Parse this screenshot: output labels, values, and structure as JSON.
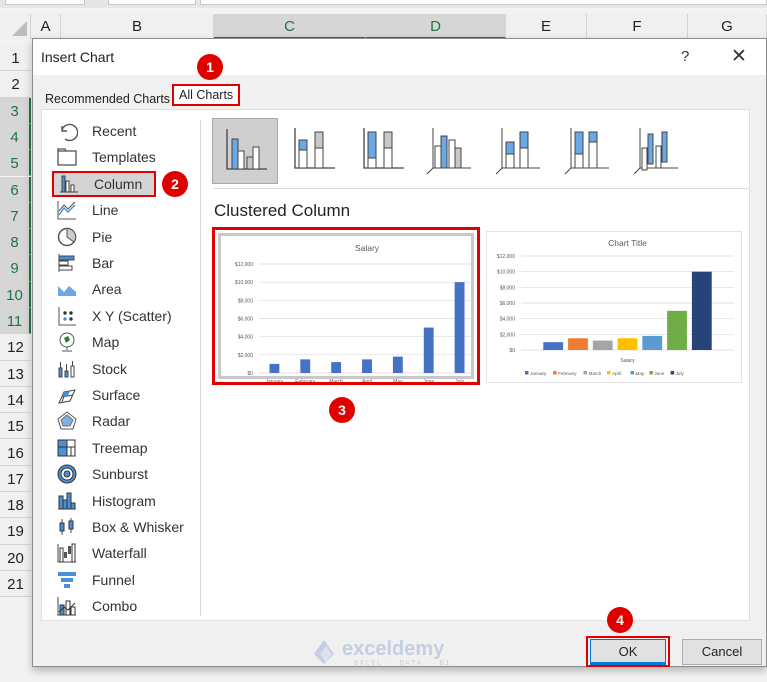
{
  "spreadsheet": {
    "columns": [
      "A",
      "B",
      "C",
      "D",
      "E",
      "F",
      "G"
    ],
    "selected_columns": [
      "C",
      "D"
    ],
    "rows": [
      "1",
      "2",
      "3",
      "4",
      "5",
      "6",
      "7",
      "8",
      "9",
      "10",
      "11",
      "12",
      "13",
      "14",
      "15",
      "16",
      "17",
      "18",
      "19",
      "20",
      "21"
    ],
    "selected_rows": [
      "3",
      "4",
      "5",
      "6",
      "7",
      "8",
      "9",
      "10",
      "11"
    ]
  },
  "dialog": {
    "title": "Insert Chart",
    "help_label": "?",
    "close_label": "✕",
    "tabs": [
      {
        "label": "Recommended Charts",
        "active": false
      },
      {
        "label": "All Charts",
        "active": true
      }
    ],
    "sidebar": {
      "items": [
        {
          "label": "Recent",
          "icon": "recent-icon"
        },
        {
          "label": "Templates",
          "icon": "templates-icon"
        },
        {
          "label": "Column",
          "icon": "column-chart-icon",
          "active": true
        },
        {
          "label": "Line",
          "icon": "line-chart-icon"
        },
        {
          "label": "Pie",
          "icon": "pie-chart-icon"
        },
        {
          "label": "Bar",
          "icon": "bar-chart-icon"
        },
        {
          "label": "Area",
          "icon": "area-chart-icon"
        },
        {
          "label": "X Y (Scatter)",
          "icon": "scatter-chart-icon"
        },
        {
          "label": "Map",
          "icon": "map-chart-icon"
        },
        {
          "label": "Stock",
          "icon": "stock-chart-icon"
        },
        {
          "label": "Surface",
          "icon": "surface-chart-icon"
        },
        {
          "label": "Radar",
          "icon": "radar-chart-icon"
        },
        {
          "label": "Treemap",
          "icon": "treemap-chart-icon"
        },
        {
          "label": "Sunburst",
          "icon": "sunburst-chart-icon"
        },
        {
          "label": "Histogram",
          "icon": "histogram-chart-icon"
        },
        {
          "label": "Box & Whisker",
          "icon": "box-whisker-chart-icon"
        },
        {
          "label": "Waterfall",
          "icon": "waterfall-chart-icon"
        },
        {
          "label": "Funnel",
          "icon": "funnel-chart-icon"
        },
        {
          "label": "Combo",
          "icon": "combo-chart-icon"
        }
      ]
    },
    "subtypes": [
      {
        "name": "clustered-column",
        "active": true
      },
      {
        "name": "stacked-column"
      },
      {
        "name": "100-stacked-column"
      },
      {
        "name": "3d-clustered-column"
      },
      {
        "name": "3d-stacked-column"
      },
      {
        "name": "3d-100-stacked-column"
      },
      {
        "name": "3d-column"
      }
    ],
    "subtype_title": "Clustered Column",
    "ok_label": "OK",
    "cancel_label": "Cancel",
    "watermark": {
      "brand": "exceldemy",
      "tagline": "EXCEL · DATA · BI"
    }
  },
  "badges": [
    "1",
    "2",
    "3",
    "4"
  ],
  "colors": {
    "accent_red": "#e00000",
    "excel_green": "#217346",
    "bar_blue": "#4472c4",
    "icon_blue": "#4a90d9"
  },
  "chart_data": [
    {
      "type": "bar",
      "title": "Salary",
      "categories": [
        "January",
        "February",
        "March",
        "April",
        "May",
        "June",
        "July"
      ],
      "values": [
        1000,
        1500,
        1200,
        1500,
        1800,
        5000,
        10000
      ],
      "ylim": [
        0,
        12000
      ],
      "yticks": [
        "$0",
        "$2,000",
        "$4,000",
        "$6,000",
        "$8,000",
        "$10,000",
        "$12,000"
      ],
      "xlabel": "",
      "ylabel": "",
      "grid": true,
      "color": "#4472c4"
    },
    {
      "type": "bar",
      "title": "Chart Title",
      "categories": [
        "Salary"
      ],
      "series": [
        {
          "name": "January",
          "values": [
            1000
          ],
          "color": "#4472c4"
        },
        {
          "name": "February",
          "values": [
            1500
          ],
          "color": "#ed7d31"
        },
        {
          "name": "March",
          "values": [
            1200
          ],
          "color": "#a5a5a5"
        },
        {
          "name": "April",
          "values": [
            1500
          ],
          "color": "#ffc000"
        },
        {
          "name": "May",
          "values": [
            1800
          ],
          "color": "#5b9bd5"
        },
        {
          "name": "June",
          "values": [
            5000
          ],
          "color": "#70ad47"
        },
        {
          "name": "July",
          "values": [
            10000
          ],
          "color": "#264478"
        }
      ],
      "ylim": [
        0,
        12000
      ],
      "yticks": [
        "$0",
        "$2,000",
        "$4,000",
        "$6,000",
        "$8,000",
        "$10,000",
        "$12,000"
      ],
      "xlabel": "Salary",
      "grid": true,
      "legend": "bottom"
    }
  ]
}
